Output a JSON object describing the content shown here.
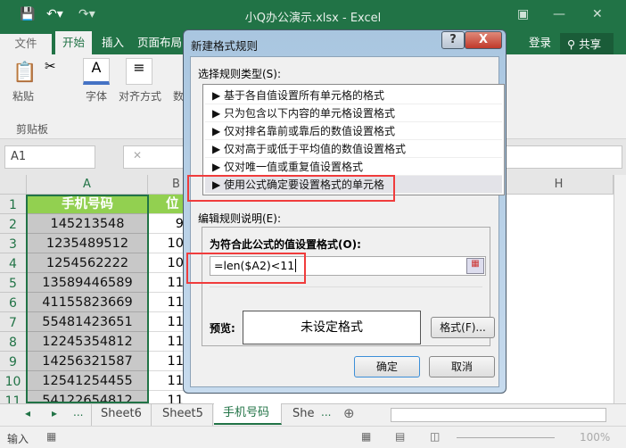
{
  "window": {
    "title": "小Q办公演示.xlsx - Excel"
  },
  "ribbon": {
    "tabs": [
      "文件",
      "开始",
      "插入",
      "页面布局"
    ],
    "login": "登录",
    "share": "共享",
    "paste": "粘贴",
    "font": "字体",
    "align": "对齐方式",
    "number": "数",
    "clipboard": "剪贴板"
  },
  "formula_bar": {
    "name_box": "A1"
  },
  "grid": {
    "columns": [
      "A",
      "B",
      "H"
    ],
    "rows": [
      "1",
      "2",
      "3",
      "4",
      "5",
      "6",
      "7",
      "8",
      "9",
      "10",
      "11"
    ],
    "header_a": "手机号码",
    "header_b": "位数",
    "col_a": [
      "145213548",
      "1235489512",
      "1254562222",
      "13589446589",
      "41155823669",
      "55481423651",
      "12245354812",
      "14256321587",
      "12541254455",
      "54122654812"
    ],
    "col_b": [
      "9",
      "10",
      "10",
      "11",
      "11",
      "11",
      "11",
      "11",
      "11",
      "11"
    ]
  },
  "sheets": {
    "tabs": [
      "Sheet6",
      "Sheet5",
      "手机号码",
      "She"
    ],
    "active": "手机号码",
    "more": "..."
  },
  "status": {
    "mode": "输入",
    "zoom": "100%"
  },
  "dialog": {
    "title": "新建格式规则",
    "help": "?",
    "close": "X",
    "rule_type_label": "选择规则类型(S):",
    "rule_types": [
      "基于各自值设置所有单元格的格式",
      "只为包含以下内容的单元格设置格式",
      "仅对排名靠前或靠后的数值设置格式",
      "仅对高于或低于平均值的数值设置格式",
      "仅对唯一值或重复值设置格式",
      "使用公式确定要设置格式的单元格"
    ],
    "selected_rule": 5,
    "edit_label": "编辑规则说明(E):",
    "formula_label": "为符合此公式的值设置格式(O):",
    "formula": "=len($A2)<11",
    "preview_label": "预览:",
    "preview_text": "未设定格式",
    "format_button": "格式(F)...",
    "ok": "确定",
    "cancel": "取消"
  },
  "colors": {
    "excel_green": "#217346",
    "header_fill": "#92d050",
    "highlight": "#f03c3c"
  }
}
